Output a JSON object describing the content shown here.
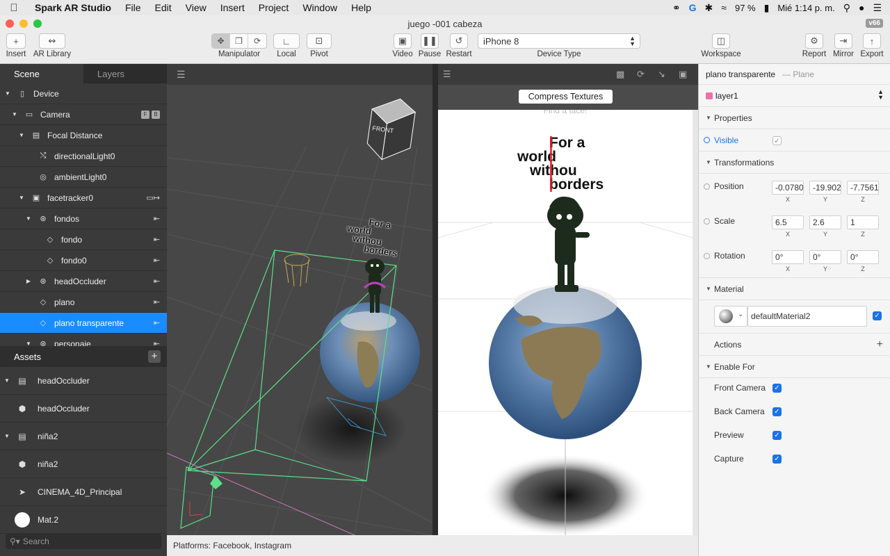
{
  "menubar": {
    "app": "Spark AR Studio",
    "items": [
      "File",
      "Edit",
      "View",
      "Insert",
      "Project",
      "Window",
      "Help"
    ],
    "battery": "97 %",
    "clock": "Mié 1:14 p. m."
  },
  "window": {
    "title": "juego -001 cabeza",
    "version": "v66"
  },
  "toolbar": {
    "insert": "Insert",
    "ar_library": "AR Library",
    "manipulator": "Manipulator",
    "local": "Local",
    "pivot": "Pivot",
    "video": "Video",
    "pause": "Pause",
    "restart": "Restart",
    "device_value": "iPhone 8",
    "device_type": "Device Type",
    "workspace": "Workspace",
    "report": "Report",
    "mirror": "Mirror",
    "export": "Export"
  },
  "scene": {
    "tab_scene": "Scene",
    "tab_layers": "Layers",
    "items": [
      {
        "label": "Device",
        "indent": 0,
        "twisty": "down",
        "icon": "device-icon"
      },
      {
        "label": "Camera",
        "indent": 1,
        "twisty": "down",
        "icon": "camera-icon",
        "badges": [
          "F",
          "B"
        ]
      },
      {
        "label": "Focal Distance",
        "indent": 2,
        "twisty": "down",
        "icon": "focal-icon"
      },
      {
        "label": "directionalLight0",
        "indent": 3,
        "twisty": "",
        "icon": "directional-light-icon"
      },
      {
        "label": "ambientLight0",
        "indent": 3,
        "twisty": "",
        "icon": "ambient-light-icon"
      },
      {
        "label": "facetracker0",
        "indent": 2,
        "twisty": "down",
        "icon": "facetracker-icon"
      },
      {
        "label": "fondos",
        "indent": 3,
        "twisty": "down",
        "icon": "null-object-icon"
      },
      {
        "label": "fondo",
        "indent": 4,
        "twisty": "",
        "icon": "plane-icon"
      },
      {
        "label": "fondo0",
        "indent": 4,
        "twisty": "",
        "icon": "plane-icon"
      },
      {
        "label": "headOccluder",
        "indent": 3,
        "twisty": "right",
        "icon": "null-object-icon"
      },
      {
        "label": "plano",
        "indent": 3,
        "twisty": "",
        "icon": "plane-icon"
      },
      {
        "label": "plano transparente",
        "indent": 3,
        "twisty": "",
        "icon": "plane-icon",
        "selected": true
      },
      {
        "label": "personaje",
        "indent": 3,
        "twisty": "down",
        "icon": "null-object-icon"
      }
    ]
  },
  "assets": {
    "title": "Assets",
    "items": [
      {
        "label": "headOccluder",
        "twisty": "down",
        "icon": "fbx-icon"
      },
      {
        "label": "headOccluder",
        "twisty": "",
        "icon": "mesh-icon"
      },
      {
        "label": "niña2",
        "twisty": "down",
        "icon": "fbx-icon"
      },
      {
        "label": "niña2",
        "twisty": "",
        "icon": "mesh-icon"
      },
      {
        "label": "CINEMA_4D_Principal",
        "twisty": "",
        "icon": "animation-icon"
      },
      {
        "label": "Mat.2",
        "twisty": "",
        "icon": "material-icon"
      }
    ],
    "search_placeholder": "Search"
  },
  "viewport": {
    "overlay_text": [
      "For a",
      "world",
      "withou",
      "borders"
    ]
  },
  "preview": {
    "compress_label": "Compress Textures",
    "find_face": "Find a face!",
    "overlay_text": [
      "For a",
      "world",
      "withou",
      "borders"
    ]
  },
  "status": {
    "platforms": "Platforms: Facebook, Instagram"
  },
  "inspector": {
    "object_name": "plano transparente",
    "object_type": "— Plane",
    "layer": "layer1",
    "properties": "Properties",
    "visible": "Visible",
    "transformations": "Transformations",
    "position_label": "Position",
    "position": [
      "-0.0780",
      "-19.902",
      "-7.7561"
    ],
    "scale_label": "Scale",
    "scale": [
      "6.5",
      "2.6",
      "1"
    ],
    "rotation_label": "Rotation",
    "rotation": [
      "0°",
      "0°",
      "0°"
    ],
    "axes": [
      "X",
      "Y",
      "Z"
    ],
    "material_section": "Material",
    "material_value": "defaultMaterial2",
    "actions": "Actions",
    "enable_for": "Enable For",
    "front_camera": "Front Camera",
    "back_camera": "Back Camera",
    "preview_opt": "Preview",
    "capture": "Capture"
  },
  "colors": {
    "selection": "#1a8cff",
    "layer_swatch": "#f06ea9",
    "checkbox": "#1a73e8",
    "frustum": "#5ce08a"
  }
}
